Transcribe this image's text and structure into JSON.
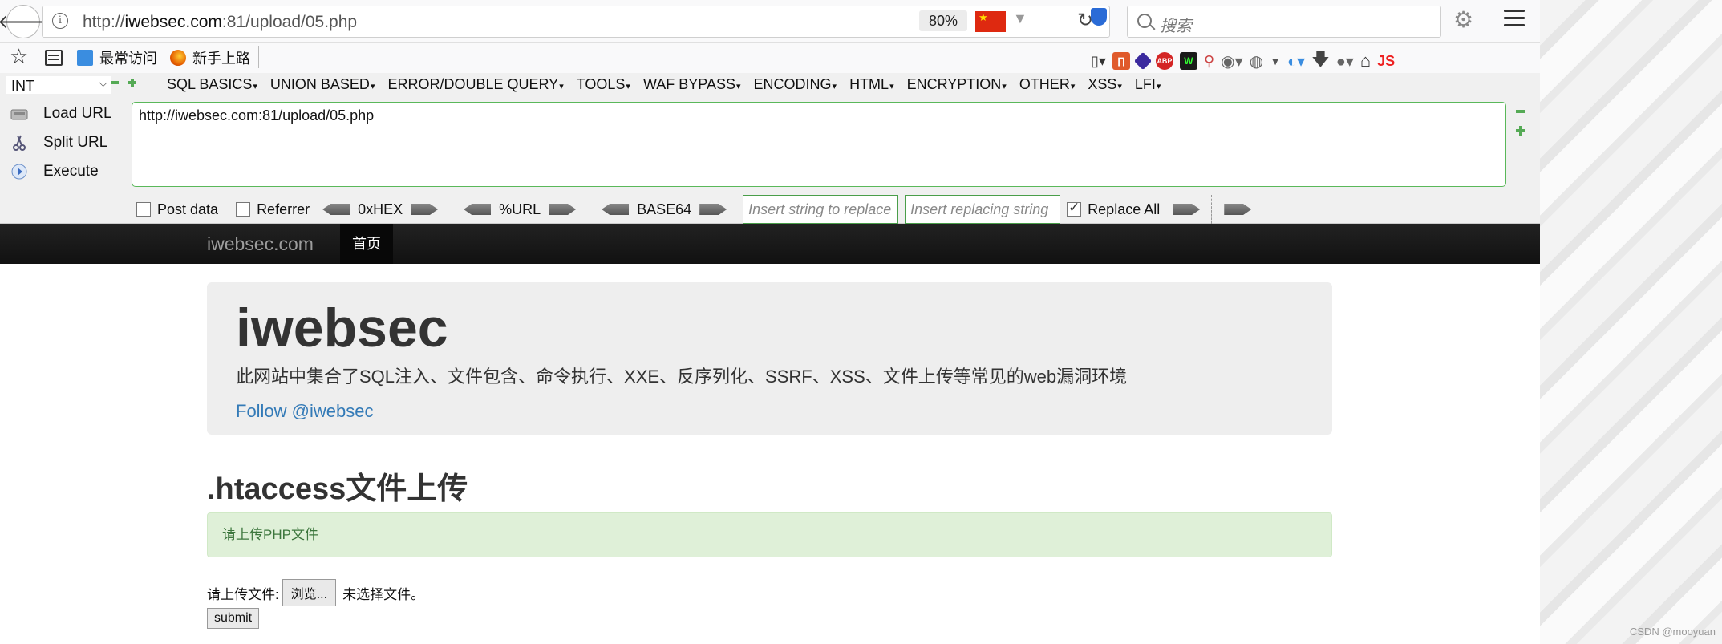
{
  "browser": {
    "url_prefix": "http://",
    "url_domain": "iwebsec.com",
    "url_suffix": ":81/upload/05.php",
    "zoom": "80%",
    "search_placeholder": "搜索"
  },
  "bookmarks": {
    "items": [
      "最常访问",
      "新手上路"
    ]
  },
  "extensions": [
    "ABP",
    "JS"
  ],
  "hackbar": {
    "select_value": "INT",
    "menus": [
      "SQL BASICS",
      "UNION BASED",
      "ERROR/DOUBLE QUERY",
      "TOOLS",
      "WAF BYPASS",
      "ENCODING",
      "HTML",
      "ENCRYPTION",
      "OTHER",
      "XSS",
      "LFI"
    ],
    "load_url": "Load URL",
    "split_url": "Split URL",
    "execute": "Execute",
    "url_value": "http://iwebsec.com:81/upload/05.php",
    "post_data": "Post data",
    "referrer": "Referrer",
    "hex": "0xHEX",
    "urlenc": "%URL",
    "base64": "BASE64",
    "replace_placeholder": "Insert string to replace",
    "replacing_placeholder": "Insert replacing string",
    "replace_all": "Replace All",
    "replace_all_checked": true
  },
  "site": {
    "brand": "iwebsec.com",
    "nav_home": "首页",
    "title": "iwebsec",
    "description": "此网站中集合了SQL注入、文件包含、命令执行、XXE、反序列化、SSRF、XSS、文件上传等常见的web漏洞环境",
    "follow": "Follow @iwebsec",
    "section_title": ".htaccess文件上传",
    "alert": "请上传PHP文件",
    "upload_label": "请上传文件:",
    "browse_label": "浏览...",
    "no_file": "未选择文件。",
    "submit_label": "submit"
  },
  "watermark": "CSDN @mooyuan"
}
